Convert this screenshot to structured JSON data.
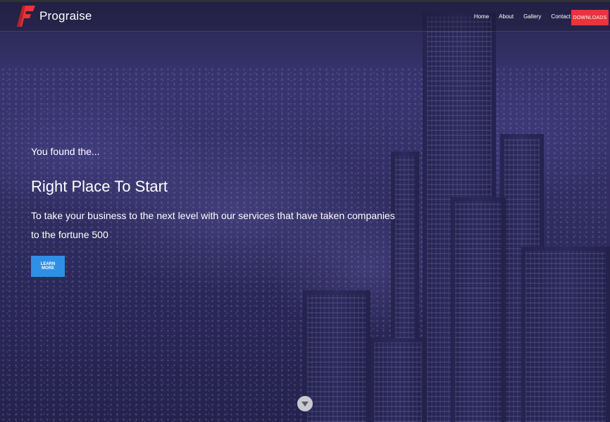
{
  "brand": {
    "name": "Prograise",
    "logo_color": "#e8343c"
  },
  "nav": {
    "items": [
      "Home",
      "About",
      "Gallery",
      "Contact"
    ],
    "downloads_label": "DOWNLOADS",
    "downloads_color": "#e8343c"
  },
  "hero": {
    "kicker": "You found the...",
    "title": "Right Place To Start",
    "description": "To take your business to the next level with our services that have taken companies to the fortune 500",
    "cta_label": "LEARN MORE",
    "cta_color": "#2f8fe6",
    "scroll_icon": "chevron-down-icon"
  }
}
